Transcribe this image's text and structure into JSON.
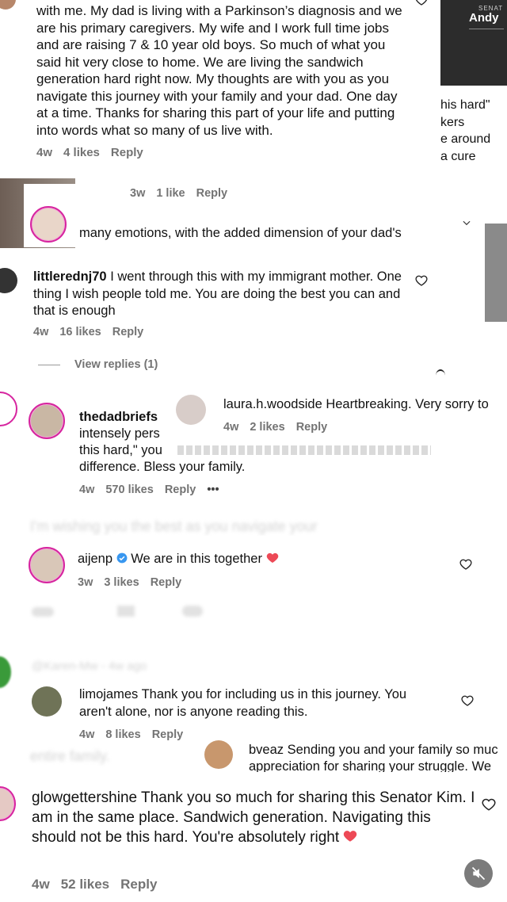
{
  "c1": {
    "text": "with me. My dad is living with a Parkinson’s diagnosis and we are his primary caregivers. My wife and I work full time jobs and are raising 7 & 10 year old boys. So much of what you said hit very close to home. We are living the sandwich generation hard right now. My thoughts are with you as you navigate this journey with your family and your dad. One day at a time. Thanks for sharing this part of your life and putting into words what so many of us live with.",
    "age": "4w",
    "likes": "4 likes",
    "reply": "Reply"
  },
  "video_panel": {
    "label_small": "SENAT",
    "label_name": "Andy"
  },
  "right_fragment": [
    "his hard\"",
    "kers",
    "e around",
    "a cure"
  ],
  "mini_meta": {
    "age": "3w",
    "likes": "1 like",
    "reply": "Reply"
  },
  "c2": {
    "text": "many emotions, with the added dimension of your dad's"
  },
  "c3": {
    "user": "littlerednj70",
    "text": "I went through this with my immigrant mother. One thing I wish people told me. You are doing the best you can and that is enough",
    "age": "4w",
    "likes": "16 likes",
    "reply": "Reply",
    "view_replies": "View replies (1)"
  },
  "c4": {
    "user": "laura.h.woodside",
    "text": "Heartbreaking. Very sorry to",
    "age": "4w",
    "likes": "2 likes",
    "reply": "Reply"
  },
  "c5": {
    "user": "thedadbriefs",
    "line1": "intensely pers",
    "line2": "this hard,\" you",
    "line3": "difference. Bless your family.",
    "age": "4w",
    "likes": "570 likes",
    "reply": "Reply",
    "more": "•••"
  },
  "blur_text": {
    "b1": "I'm wishing you the best as you navigate your",
    "b2": "@Karen-Mw - 4w ago",
    "b3": "entire family."
  },
  "c6": {
    "user": "aijenp",
    "text": "We are in this together",
    "age": "3w",
    "likes": "3 likes",
    "reply": "Reply"
  },
  "c7": {
    "user": "limojames",
    "text": "Thank you for including us in this journey. You aren't alone, nor is anyone reading this.",
    "age": "4w",
    "likes": "8 likes",
    "reply": "Reply"
  },
  "c8": {
    "user": "bveaz",
    "line1": "Sending you and your family so muc",
    "line2": "appreciation for sharing your struggle. We"
  },
  "c9": {
    "user": "glowgettershine",
    "text": "Thank you so much for sharing this Senator Kim. I am in the same place. Sandwich generation. Navigating this should not be this hard. You're absolutely right",
    "age": "4w",
    "likes": "52 likes",
    "reply": "Reply"
  },
  "colors": {
    "heart_red": "#ed4956",
    "verified_blue": "#3897f0",
    "meta_gray": "#737373",
    "ring_pink": "#d6249f"
  },
  "icons": [
    "heart-icon",
    "verified-badge-icon",
    "red-heart-emoji-icon",
    "mute-icon",
    "chevron-down-icon"
  ]
}
